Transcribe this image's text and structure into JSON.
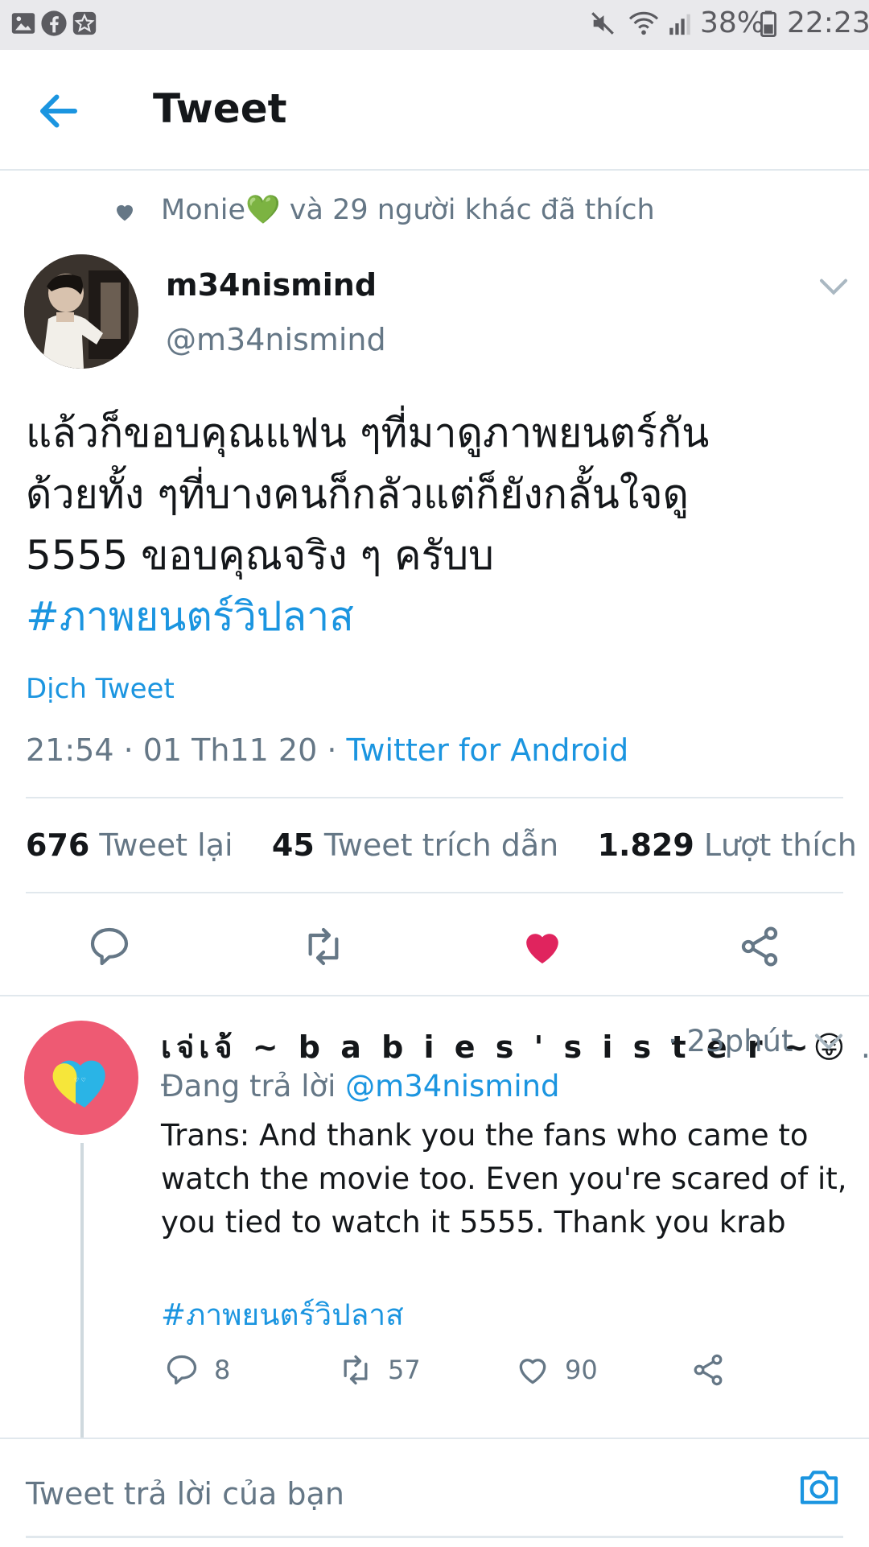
{
  "status_bar": {
    "battery": "38%",
    "time": "22:23"
  },
  "header": {
    "title": "Tweet"
  },
  "liked_by": {
    "name": "Monie",
    "emoji": "💚",
    "rest": "và 29 người khác đã thích"
  },
  "tweet": {
    "author_name": "m34nismind",
    "author_handle": "@m34nismind",
    "text_lines": [
      "แล้วก็ขอบคุณแฟน ๆที่มาดูภาพยนตร์กัน",
      "ด้วยทั้ง ๆที่บางคนก็กลัวแต่ก็ยังกลั้นใจดู",
      "5555 ขอบคุณจริง ๆ ครับบ"
    ],
    "hashtag": "#ภาพยนตร์วิปลาส",
    "translate": "Dịch Tweet",
    "time": "21:54 · 01 Th11 20 · ",
    "source": "Twitter for Android",
    "stats": {
      "retweets": "676",
      "retweets_label": "Tweet lại",
      "quotes": "45",
      "quotes_label": "Tweet trích dẫn",
      "likes": "1.829",
      "likes_label": "Lượt thích"
    }
  },
  "reply": {
    "author_name": "เจ่เจ้ ~ b a b i e s ' s i s t e r ~",
    "emoji": "😜",
    "ellipsis": "…",
    "time": "· 23phút",
    "replying_prefix": "Đang trả lời ",
    "replying_handle": "@m34nismind",
    "body": "Trans: And thank you the fans who came to watch the movie too. Even you're scared of it, you tied to watch it 5555. Thank you krab",
    "hashtag": "#ภาพยนตร์วิปลาส",
    "counts": {
      "replies": "8",
      "retweets": "57",
      "likes": "90"
    }
  },
  "compose": {
    "placeholder": "Tweet trả lời của bạn"
  },
  "colors": {
    "accent": "#1b95e0",
    "like": "#e0245e",
    "muted": "#657786"
  }
}
